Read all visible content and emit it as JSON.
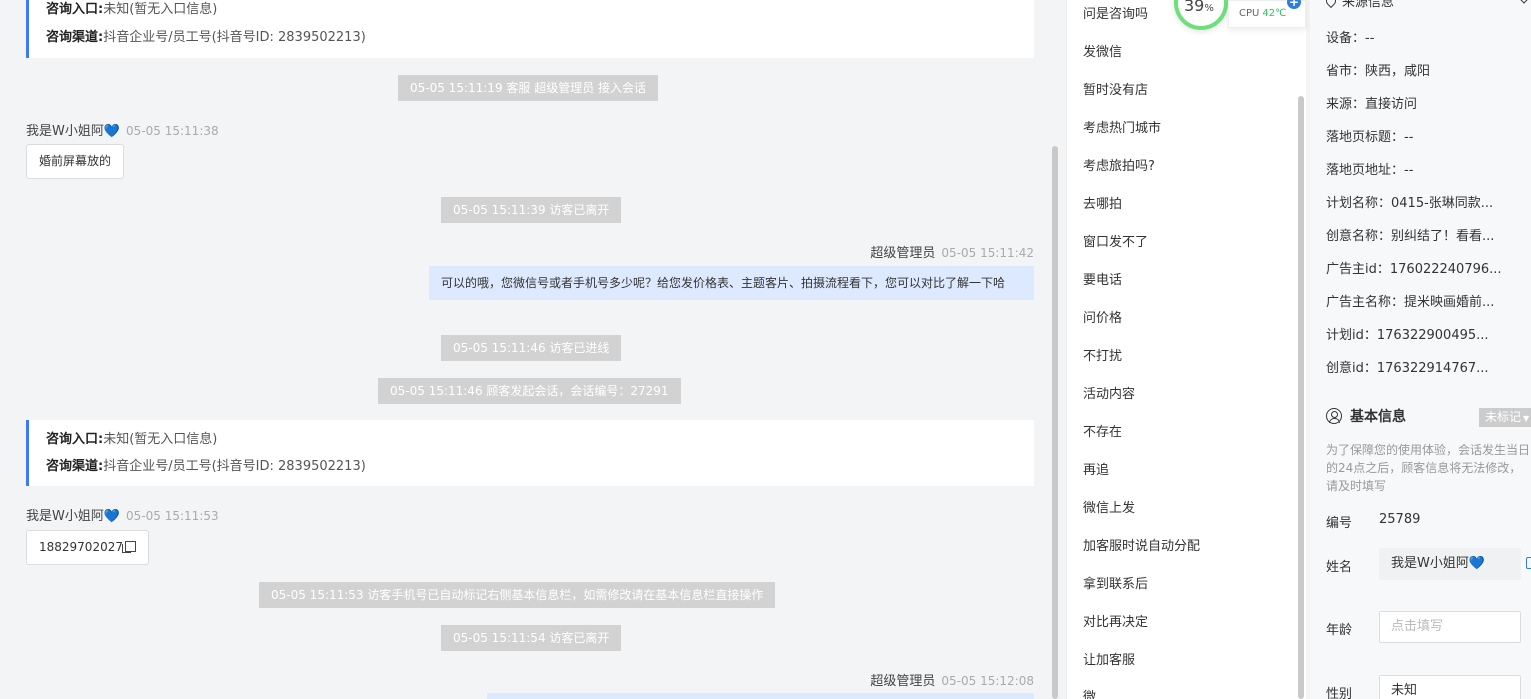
{
  "chat": {
    "card1": {
      "entry_label": "咨询入口:",
      "entry_value": "未知(暂无入口信息)",
      "channel_label": "咨询渠道:",
      "channel_value": "抖音企业号/员工号(抖音号ID: 2839502213)"
    },
    "sys1": "05-05 15:11:19 客服 超级管理员 接入会话",
    "visitor_name": "我是W小姐阿",
    "heart": "💙",
    "msg1_time": "05-05 15:11:38",
    "msg1_text": "婚前屏幕放的",
    "sys2": "05-05 15:11:39 访客已离开",
    "agent_name": "超级管理员",
    "reply1_time": "05-05 15:11:42",
    "reply1_text": "可以的哦，您微信号或者手机号多少呢？给您发价格表、主题客片、拍摄流程看下，您可以对比了解一下哈",
    "sys3": "05-05 15:11:46 访客已进线",
    "sys4": "05-05 15:11:46 顾客发起会话，会话编号：27291",
    "card2": {
      "entry_label": "咨询入口:",
      "entry_value": "未知(暂无入口信息)",
      "channel_label": "咨询渠道:",
      "channel_value": "抖音企业号/员工号(抖音号ID: 2839502213)"
    },
    "msg2_time": "05-05 15:11:53",
    "msg2_text": "18829702027",
    "sys5": "05-05 15:11:53 访客手机号已自动标记右侧基本信息栏，如需修改请在基本信息栏直接操作",
    "sys6": "05-05 15:11:54 访客已离开",
    "reply2_time": "05-05 15:12:08"
  },
  "cpu": {
    "percent": "39",
    "unit": "%",
    "label": "CPU",
    "temp": "42℃",
    "plus": "+"
  },
  "quick_replies": [
    "问是咨询吗",
    "发微信",
    "暂时没有店",
    "考虑热门城市",
    "考虑旅拍吗?",
    "去哪拍",
    "窗口发不了",
    "要电话",
    "问价格",
    "不打扰",
    "活动内容",
    "不存在",
    "再追",
    "微信上发",
    "加客服时说自动分配",
    "拿到联系后",
    "对比再决定",
    "让加客服",
    "微"
  ],
  "source": {
    "title": "来源信息",
    "rows": [
      {
        "label": "设备：",
        "value": "--"
      },
      {
        "label": "省市：",
        "value": "陕西，咸阳"
      },
      {
        "label": "来源：",
        "value": "直接访问"
      },
      {
        "label": "落地页标题：",
        "value": "--"
      },
      {
        "label": "落地页地址：",
        "value": "--"
      },
      {
        "label": "计划名称：",
        "value": "0415-张琳同款..."
      },
      {
        "label": "创意名称：",
        "value": "别纠结了！看看..."
      },
      {
        "label": "广告主id：",
        "value": "176022240796..."
      },
      {
        "label": "广告主名称：",
        "value": "提米映画婚前..."
      },
      {
        "label": "计划id：",
        "value": "176322900495..."
      },
      {
        "label": "创意id：",
        "value": "176322914767..."
      }
    ]
  },
  "basic": {
    "title": "基本信息",
    "tag": "未标记",
    "note": "为了保障您的使用体验，会话发生当日的24点之后，顾客信息将无法修改，请及时填写",
    "id_label": "编号",
    "id_value": "25789",
    "name_label": "姓名",
    "name_value": "我是W小姐阿💙",
    "age_label": "年龄",
    "age_placeholder": "点击填写",
    "gender_label": "性别",
    "gender_value": "未知"
  }
}
